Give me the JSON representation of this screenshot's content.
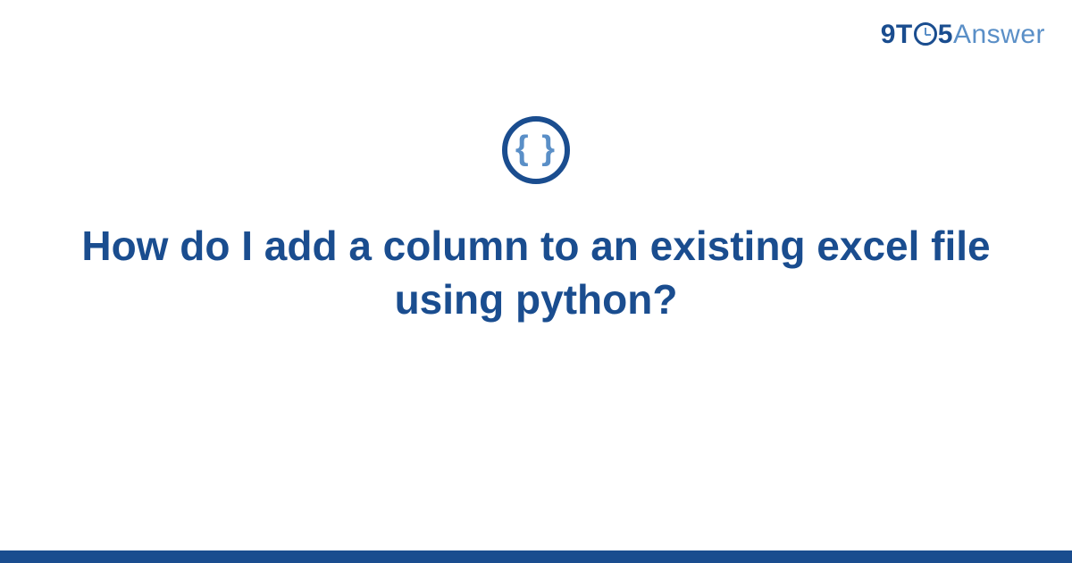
{
  "brand": {
    "part1": "9T",
    "part2": "5",
    "part3": "Answer"
  },
  "icon": {
    "name": "code-braces-icon",
    "glyph": "{ }"
  },
  "question": {
    "title": "How do I add a column to an existing excel file using python?"
  },
  "colors": {
    "primary": "#1a4d8f",
    "secondary": "#5a8fc7"
  }
}
